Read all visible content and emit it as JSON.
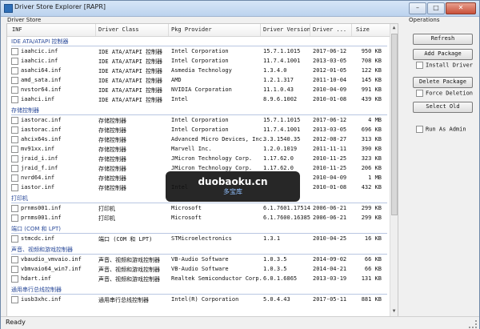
{
  "window": {
    "title": "Driver Store Explorer [RAPR]",
    "buttons": [
      "–",
      "□",
      "✕"
    ]
  },
  "groups": {
    "store_label": "Driver Store",
    "ops_label": "Operations"
  },
  "table": {
    "columns": [
      "INF",
      "Driver Class",
      "Pkg Provider",
      "Driver Version",
      "Driver ...",
      "Size"
    ],
    "sections": [
      {
        "title": "IDE ATA/ATAPI 控制器",
        "rows": [
          [
            "iaahcic.inf",
            "IDE ATA/ATAPI 控制器",
            "Intel Corporation",
            "15.7.1.1015",
            "2017-06-12",
            "950 KB"
          ],
          [
            "iaahcic.inf",
            "IDE ATA/ATAPI 控制器",
            "Intel Corporation",
            "11.7.4.1001",
            "2013-03-05",
            "708 KB"
          ],
          [
            "asahci64.inf",
            "IDE ATA/ATAPI 控制器",
            "Asmedia Technology",
            "1.3.4.0",
            "2012-01-05",
            "122 KB"
          ],
          [
            "amd_sata.inf",
            "IDE ATA/ATAPI 控制器",
            "AMD",
            "1.2.1.317",
            "2011-10-04",
            "145 KB"
          ],
          [
            "nvstor64.inf",
            "IDE ATA/ATAPI 控制器",
            "NVIDIA Corporation",
            "11.1.0.43",
            "2010-04-09",
            "991 KB"
          ],
          [
            "iaahci.inf",
            "IDE ATA/ATAPI 控制器",
            "Intel",
            "8.9.6.1002",
            "2010-01-08",
            "439 KB"
          ]
        ]
      },
      {
        "title": "存储控制器",
        "rows": [
          [
            "iastorac.inf",
            "存储控制器",
            "Intel Corporation",
            "15.7.1.1015",
            "2017-06-12",
            "4 MB"
          ],
          [
            "iastorac.inf",
            "存储控制器",
            "Intel Corporation",
            "11.7.4.1001",
            "2013-03-05",
            "696 KB"
          ],
          [
            "ahcix64s.inf",
            "存储控制器",
            "Advanced Micro Devices, Inc.",
            "3.3.1540.35",
            "2012-08-27",
            "313 KB"
          ],
          [
            "mv91xx.inf",
            "存储控制器",
            "Marvell Inc.",
            "1.2.0.1019",
            "2011-11-11",
            "390 KB"
          ],
          [
            "jraid_i.inf",
            "存储控制器",
            "JMicron Technology Corp.",
            "1.17.62.0",
            "2010-11-25",
            "323 KB"
          ],
          [
            "jraid_f.inf",
            "存储控制器",
            "JMicron Technology Corp.",
            "1.17.62.0",
            "2010-11-25",
            "206 KB"
          ],
          [
            "nvrd64.inf",
            "存储控制器",
            "",
            "",
            "2010-04-09",
            "1 MB"
          ],
          [
            "iastor.inf",
            "存储控制器",
            "Intel",
            "",
            "2010-01-08",
            "432 KB"
          ]
        ]
      },
      {
        "title": "打印机",
        "rows": [
          [
            "prnms001.inf",
            "打印机",
            "Microsoft",
            "6.1.7601.17514",
            "2006-06-21",
            "299 KB"
          ],
          [
            "prnms001.inf",
            "打印机",
            "Microsoft",
            "6.1.7600.16385",
            "2006-06-21",
            "299 KB"
          ]
        ]
      },
      {
        "title": "端口 (COM 和 LPT)",
        "rows": [
          [
            "stmcdc.inf",
            "端口 (COM 和 LPT)",
            "STMicroelectronics",
            "1.3.1",
            "2010-04-25",
            "16 KB"
          ]
        ]
      },
      {
        "title": "声音、视频和游戏控制器",
        "rows": [
          [
            "vbaudio_vmvaio.inf",
            "声音、视频和游戏控制器",
            "VB-Audio Software",
            "1.0.3.5",
            "2014-09-02",
            "66 KB"
          ],
          [
            "vbmvaio64_win7.inf",
            "声音、视频和游戏控制器",
            "VB-Audio Software",
            "1.0.3.5",
            "2014-04-21",
            "66 KB"
          ],
          [
            "hdart.inf",
            "声音、视频和游戏控制器",
            "Realtek Semiconductor Corp.",
            "6.0.1.6865",
            "2013-03-19",
            "131 KB"
          ]
        ]
      },
      {
        "title": "通用串行总线控制器",
        "rows": [
          [
            "iusb3xhc.inf",
            "通用串行总线控制器",
            "Intel(R) Corporation",
            "5.0.4.43",
            "2017-05-11",
            "881 KB"
          ]
        ]
      }
    ]
  },
  "operations": {
    "refresh": "Refresh",
    "add_package": "Add Package",
    "install_driver": "Install Driver",
    "delete_package": "Delete Package",
    "force_deletion": "Force Deletion",
    "select_old": "Select Old",
    "run_as_admin": "Run As Admin"
  },
  "status": {
    "text": "Ready"
  },
  "watermark": {
    "line1": "duobaoku.cn",
    "line2": "多宝库"
  }
}
